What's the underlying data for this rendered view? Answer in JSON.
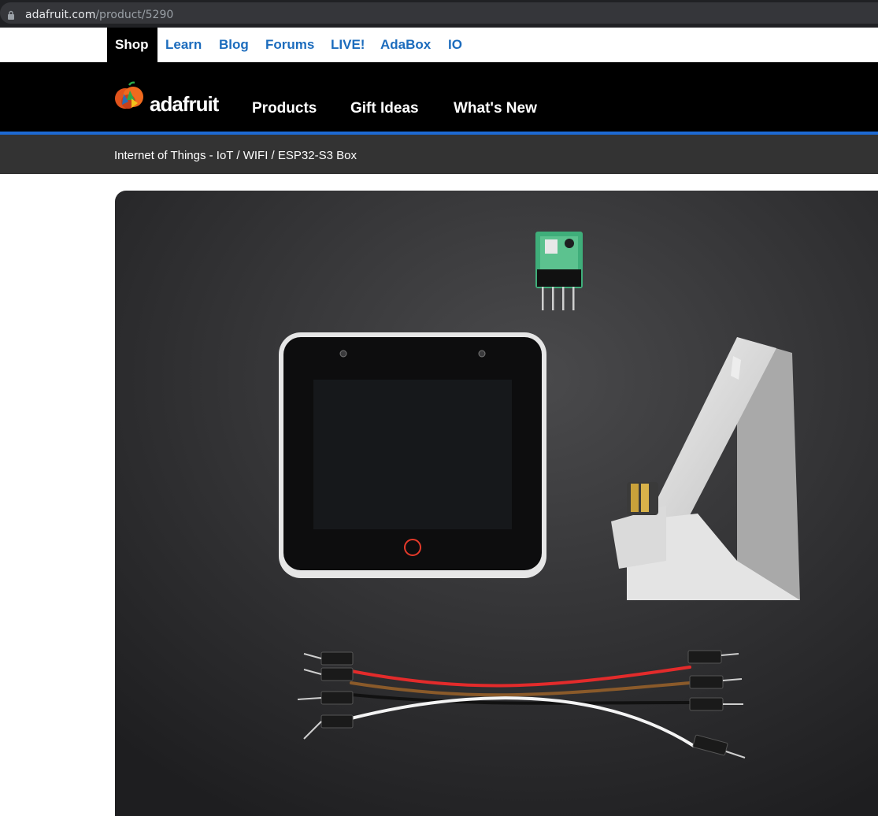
{
  "browser": {
    "url_domain": "adafruit.com",
    "url_path": "/product/5290"
  },
  "topnav": {
    "items": [
      "Shop",
      "Learn",
      "Blog",
      "Forums",
      "LIVE!",
      "AdaBox",
      "IO"
    ]
  },
  "header": {
    "logo_text": "adafruit",
    "nav": [
      "Products",
      "Gift Ideas",
      "What's New"
    ]
  },
  "breadcrumb": {
    "items": [
      "Internet of Things - IoT",
      "WIFI",
      "ESP32-S3 Box"
    ],
    "separator_1": " / ",
    "separator_2": " / "
  },
  "colors": {
    "link_blue": "#1c6cbd",
    "accent_blue": "#1d6ad3",
    "header_black": "#000000",
    "breadcrumb_bg": "#333333"
  },
  "icons": {
    "lock": "lock-icon",
    "logo": "adafruit-flower-logo"
  }
}
